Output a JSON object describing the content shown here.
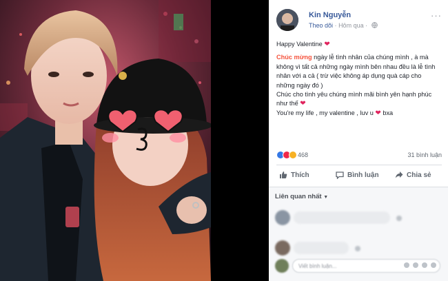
{
  "photo": {
    "alt_icon": "couple-selfie-image"
  },
  "post": {
    "author": "Kin Nguyễn",
    "follow_label": "Theo dõi",
    "separator": "·",
    "time": "Hôm qua",
    "menu": "···",
    "lines": {
      "l1": "Happy Valentine",
      "l2_highlight": "Chúc mừng",
      "l2_rest": " ngày lễ tình nhân của chúng mình , à mà không vì tất cả những ngày mình bên nhau đều là lễ tình nhân với a cả ( trừ việc không áp dụng quà cáp cho những ngày đó )",
      "l3": "Chúc cho tình yêu chúng mình mãi bình yên hạnh phúc như thế",
      "l4_a": "You're my life , my valentine , luv u",
      "l4_b": " bxa"
    },
    "heart_glyph": "❤",
    "reaction_count": "468",
    "comment_count": "31 bình luận",
    "actions": {
      "like": "Thích",
      "comment": "Bình luận",
      "share": "Chia sẻ"
    }
  },
  "comments_section": {
    "filter_label": "Liên quan nhất",
    "caret": "▼",
    "write_placeholder": "Viết bình luận..."
  },
  "colors": {
    "link": "#365899",
    "accent_red": "#f5533d",
    "heart": "#e0245e"
  }
}
